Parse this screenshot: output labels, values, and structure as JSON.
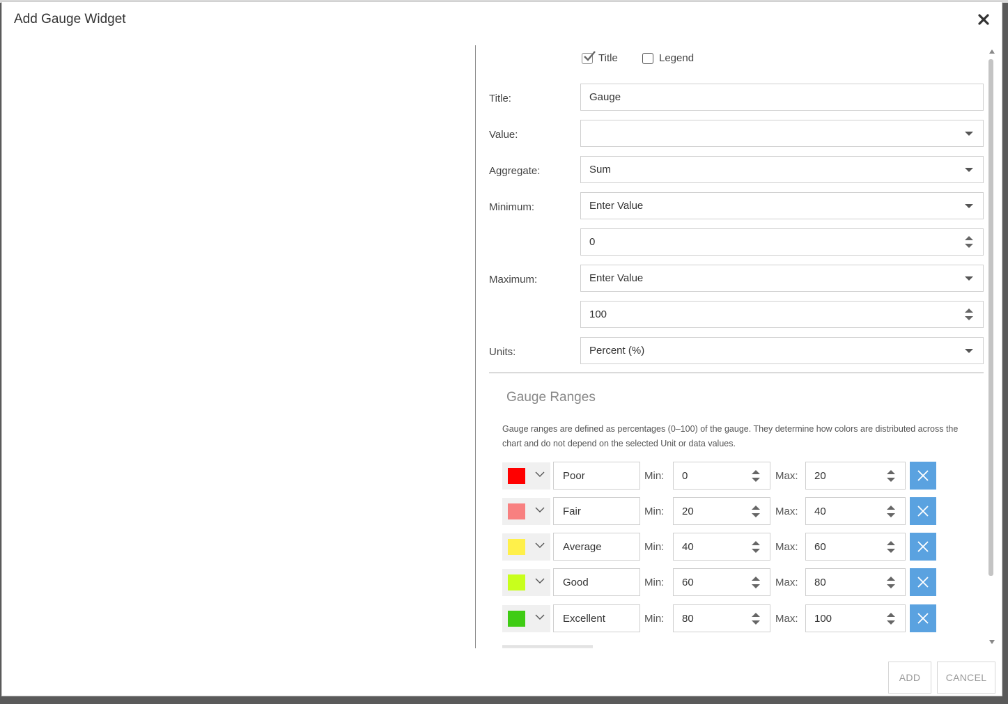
{
  "dialog": {
    "title": "Add Gauge Widget"
  },
  "options": {
    "title_checkbox_label": "Title",
    "title_checked": true,
    "legend_checkbox_label": "Legend",
    "legend_checked": false
  },
  "form": {
    "title_label": "Title:",
    "title_value": "Gauge",
    "value_label": "Value:",
    "value_value": "",
    "aggregate_label": "Aggregate:",
    "aggregate_value": "Sum",
    "minimum_label": "Minimum:",
    "minimum_mode": "Enter Value",
    "minimum_value": "0",
    "maximum_label": "Maximum:",
    "maximum_mode": "Enter Value",
    "maximum_value": "100",
    "units_label": "Units:",
    "units_value": "Percent (%)"
  },
  "ranges": {
    "heading": "Gauge Ranges",
    "description": "Gauge ranges are defined as percentages (0–100) of the gauge. They determine how colors are distributed across the chart and do not depend on the selected Unit or data values.",
    "min_label": "Min:",
    "max_label": "Max:",
    "items": [
      {
        "name": "Poor",
        "color": "#ff0000",
        "min": "0",
        "max": "20"
      },
      {
        "name": "Fair",
        "color": "#f88080",
        "min": "20",
        "max": "40"
      },
      {
        "name": "Average",
        "color": "#fff04a",
        "min": "40",
        "max": "60"
      },
      {
        "name": "Good",
        "color": "#c8ff1c",
        "min": "60",
        "max": "80"
      },
      {
        "name": "Excellent",
        "color": "#3fcc14",
        "min": "80",
        "max": "100"
      }
    ]
  },
  "footer": {
    "add_label": "ADD",
    "cancel_label": "CANCEL"
  },
  "colors": {
    "accent": "#5aa2e0"
  }
}
